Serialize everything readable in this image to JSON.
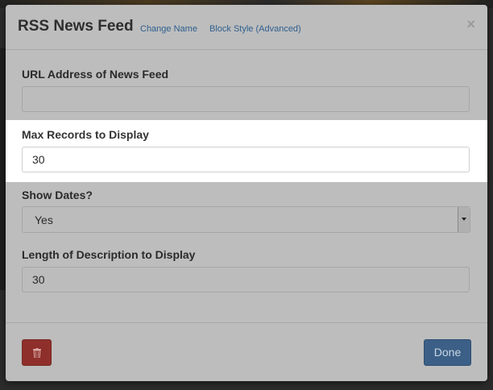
{
  "modal": {
    "title": "RSS News Feed",
    "links": {
      "change_name": "Change Name",
      "block_style": "Block Style (Advanced)"
    },
    "close_symbol": "×"
  },
  "fields": {
    "url": {
      "label": "URL Address of News Feed",
      "value": ""
    },
    "max_records": {
      "label": "Max Records to Display",
      "value": "30"
    },
    "show_dates": {
      "label": "Show Dates?",
      "selected": "Yes"
    },
    "description_length": {
      "label": "Length of Description to Display",
      "value": "30"
    }
  },
  "footer": {
    "done_label": "Done",
    "delete_icon": "trash-icon"
  },
  "colors": {
    "overlay_panel": "#bdbdbd",
    "highlight": "#ffffff",
    "delete_button": "#8e2f2b",
    "done_button": "#3b5f86",
    "link": "#2f5f8f"
  }
}
